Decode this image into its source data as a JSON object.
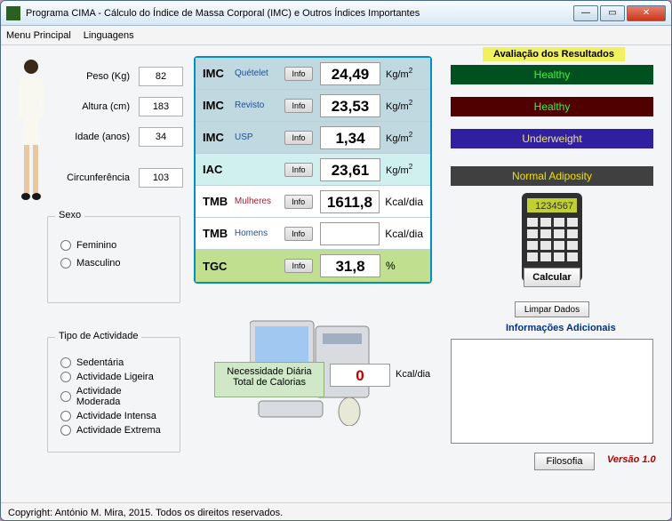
{
  "window": {
    "title": "Programa CIMA - Cálculo do Índice de Massa Corporal (IMC) e Outros Índices Importantes"
  },
  "menu": {
    "main": "Menu Principal",
    "lang": "Linguagens"
  },
  "inputs": {
    "peso": {
      "label": "Peso (Kg)",
      "value": "82"
    },
    "altura": {
      "label": "Altura (cm)",
      "value": "183"
    },
    "idade": {
      "label": "Idade (anos)",
      "value": "34"
    },
    "circ": {
      "label": "Circunferência",
      "value": "103"
    }
  },
  "sexo": {
    "legend": "Sexo",
    "fem": "Feminino",
    "masc": "Masculino"
  },
  "activity": {
    "legend": "Tipo de Actividade",
    "opts": [
      "Sedentária",
      "Actividade Ligeira",
      "Actividade Moderada",
      "Actividade Intensa",
      "Actividade Extrema"
    ]
  },
  "results": {
    "info_btn": "Info",
    "rows": [
      {
        "label": "IMC",
        "sub": "Quételet",
        "value": "24,49",
        "unit": "Kg/m",
        "sup": "2"
      },
      {
        "label": "IMC",
        "sub": "Revisto",
        "value": "23,53",
        "unit": "Kg/m",
        "sup": "2"
      },
      {
        "label": "IMC",
        "sub": "USP",
        "value": "1,34",
        "unit": "Kg/m",
        "sup": "2"
      },
      {
        "label": "IAC",
        "sub": "",
        "value": "23,61",
        "unit": "Kg/m",
        "sup": "2"
      },
      {
        "label": "TMB",
        "sub": "Mulheres",
        "value": "1611,8",
        "unit": "Kcal/dia",
        "sup": ""
      },
      {
        "label": "TMB",
        "sub": "Homens",
        "value": "",
        "unit": "Kcal/dia",
        "sup": ""
      },
      {
        "label": "TGC",
        "sub": "",
        "value": "31,8",
        "unit": "%",
        "sup": ""
      }
    ]
  },
  "calories": {
    "label": "Necessidade Diária Total de Calorias",
    "value": "0",
    "unit": "Kcal/dia"
  },
  "eval": {
    "header": "Avaliação dos Resultados",
    "items": [
      "Healthy",
      "Healthy",
      "Underweight",
      "Normal Adiposity"
    ]
  },
  "buttons": {
    "calcular": "Calcular",
    "limpar": "Limpar Dados",
    "filosofia": "Filosofia"
  },
  "info_header": "Informações Adicionais",
  "version": "Versão 1.0",
  "copyright": "Copyright: António M. Mira, 2015. Todos os direitos reservados."
}
